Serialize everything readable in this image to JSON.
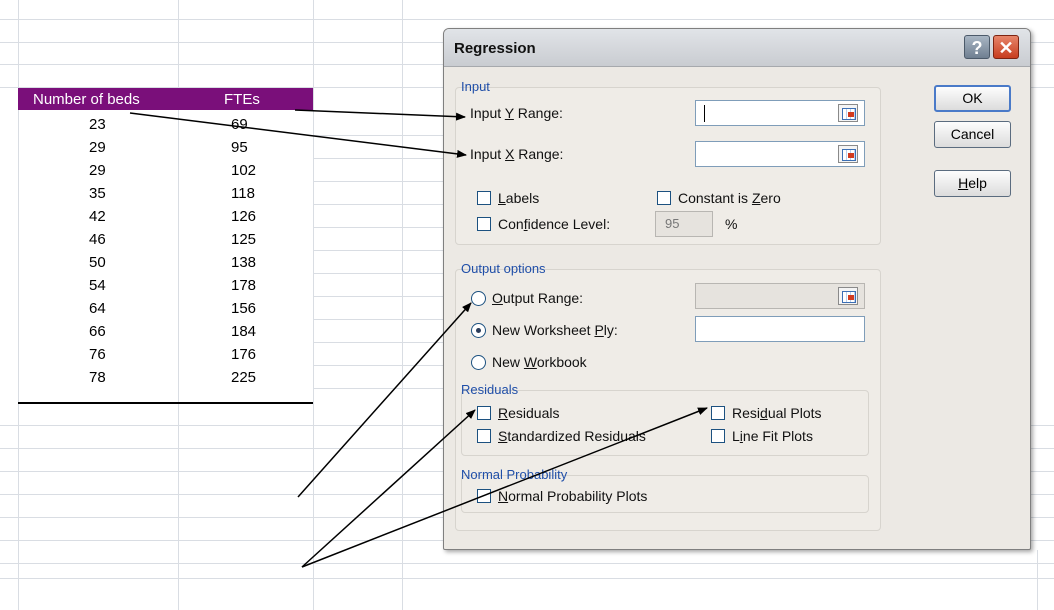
{
  "table": {
    "headers": [
      "Number of beds",
      "FTEs"
    ],
    "rows": [
      [
        "23",
        "69"
      ],
      [
        "29",
        "95"
      ],
      [
        "29",
        "102"
      ],
      [
        "35",
        "118"
      ],
      [
        "42",
        "126"
      ],
      [
        "46",
        "125"
      ],
      [
        "50",
        "138"
      ],
      [
        "54",
        "178"
      ],
      [
        "64",
        "156"
      ],
      [
        "66",
        "184"
      ],
      [
        "76",
        "176"
      ],
      [
        "78",
        "225"
      ]
    ],
    "header_color": "#7a0f7a"
  },
  "dialog": {
    "title": "Regression",
    "help_glyph": "?",
    "close_glyph": "✕",
    "buttons": {
      "ok": "OK",
      "cancel": "Cancel",
      "help": "Help"
    },
    "input": {
      "group_label": "Input",
      "y_range_label": "Input Y Range:",
      "y_range_value": "",
      "x_range_label": "Input X Range:",
      "x_range_value": "",
      "labels_label": "Labels",
      "labels_checked": false,
      "constant_zero_label": "Constant is Zero",
      "constant_zero_checked": false,
      "confidence_label": "Confidence Level:",
      "confidence_checked": false,
      "confidence_value": "95",
      "percent": "%"
    },
    "output": {
      "group_label": "Output options",
      "output_range_label": "Output Range:",
      "new_worksheet_label": "New Worksheet Ply:",
      "new_workbook_label": "New Workbook",
      "selected": "new_worksheet"
    },
    "residuals": {
      "group_label": "Residuals",
      "residuals_label": "Residuals",
      "standardized_label": "Standardized Residuals",
      "residual_plots_label": "Residual Plots",
      "line_fit_label": "Line Fit Plots"
    },
    "normal": {
      "group_label": "Normal Probability",
      "plots_label": "Normal Probability Plots"
    },
    "accent_color": "#1f4ea8"
  }
}
